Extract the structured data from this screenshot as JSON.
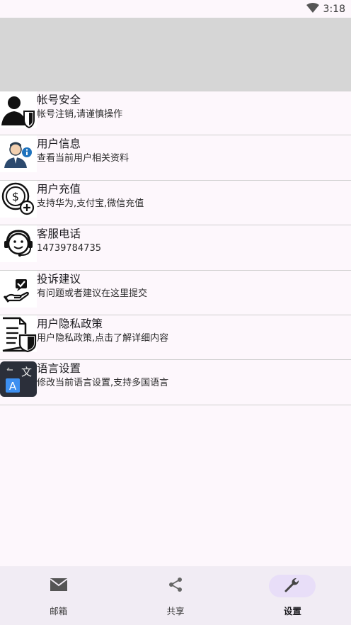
{
  "status_bar": {
    "time": "3:18",
    "wifi_icon": "wifi-icon"
  },
  "colors": {
    "background": "#fdf7fc",
    "banner": "#d6d6d6",
    "nav_bg": "#f1ecf4",
    "nav_active_pill": "#e8def8"
  },
  "settings": {
    "items": [
      {
        "icon": "account-security-icon",
        "title": "帐号安全",
        "subtitle": "帐号注销,请谨慎操作"
      },
      {
        "icon": "user-info-icon",
        "title": "用户信息",
        "subtitle": "查看当前用户相关资料"
      },
      {
        "icon": "recharge-icon",
        "title": "用户充值",
        "subtitle": "支持华为,支付宝,微信充值"
      },
      {
        "icon": "customer-service-icon",
        "title": "客服电话",
        "subtitle": "14739784735"
      },
      {
        "icon": "feedback-icon",
        "title": "投诉建议",
        "subtitle": "有问题或者建议在这里提交"
      },
      {
        "icon": "privacy-policy-icon",
        "title": "用户隐私政策",
        "subtitle": "用户隐私政策,点击了解详细内容"
      },
      {
        "icon": "language-icon",
        "title": "语言设置",
        "subtitle": "修改当前语言设置,支持多国语言"
      }
    ]
  },
  "bottom_nav": {
    "items": [
      {
        "icon": "mail-icon",
        "label": "邮箱",
        "active": false
      },
      {
        "icon": "share-icon",
        "label": "共享",
        "active": false
      },
      {
        "icon": "wrench-icon",
        "label": "设置",
        "active": true
      }
    ]
  }
}
